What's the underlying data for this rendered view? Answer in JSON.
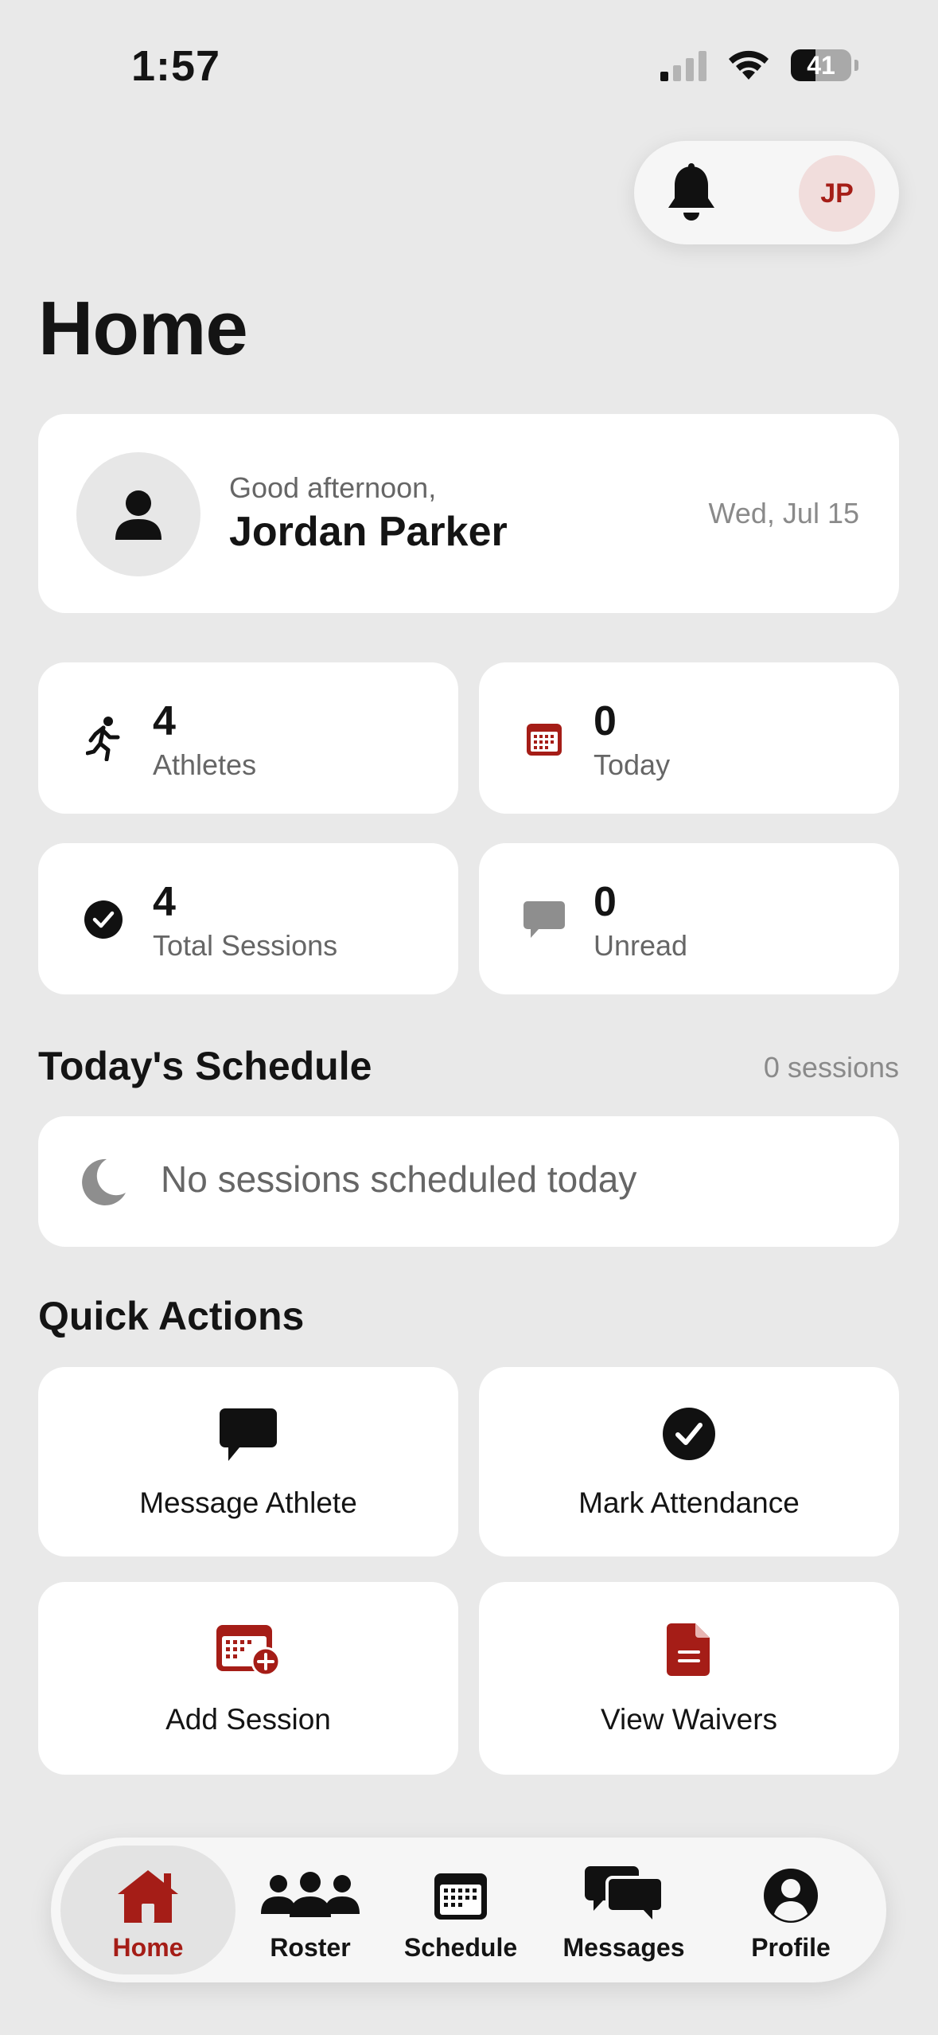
{
  "status_bar": {
    "time": "1:57",
    "battery": "41",
    "battery_level": 0.41
  },
  "header": {
    "avatar_initials": "JP"
  },
  "page_title": "Home",
  "greeting": {
    "salutation": "Good afternoon,",
    "name": "Jordan Parker",
    "date": "Wed, Jul 15"
  },
  "stats": [
    {
      "value": "4",
      "label": "Athletes",
      "icon": "runner-icon"
    },
    {
      "value": "0",
      "label": "Today",
      "icon": "calendar-icon"
    },
    {
      "value": "4",
      "label": "Total Sessions",
      "icon": "checkmark-circle-icon"
    },
    {
      "value": "0",
      "label": "Unread",
      "icon": "chat-bubble-icon"
    }
  ],
  "schedule": {
    "title": "Today's Schedule",
    "count_label": "0 sessions",
    "empty_text": "No sessions scheduled today",
    "empty_icon": "moon-icon"
  },
  "quick_actions": {
    "title": "Quick Actions",
    "items": [
      {
        "label": "Message Athlete",
        "icon": "chat-bubble-icon"
      },
      {
        "label": "Mark Attendance",
        "icon": "checkmark-circle-icon"
      },
      {
        "label": "Add Session",
        "icon": "calendar-add-icon"
      },
      {
        "label": "View Waivers",
        "icon": "document-icon"
      }
    ]
  },
  "tabs": [
    {
      "label": "Home",
      "icon": "home-icon",
      "active": true
    },
    {
      "label": "Roster",
      "icon": "people-icon",
      "active": false
    },
    {
      "label": "Schedule",
      "icon": "calendar-icon",
      "active": false
    },
    {
      "label": "Messages",
      "icon": "messages-icon",
      "active": false
    },
    {
      "label": "Profile",
      "icon": "profile-icon",
      "active": false
    }
  ],
  "colors": {
    "accent": "#a51d17",
    "background": "#e9e9e9",
    "card": "#ffffff",
    "muted_text": "#8a8a8a"
  }
}
